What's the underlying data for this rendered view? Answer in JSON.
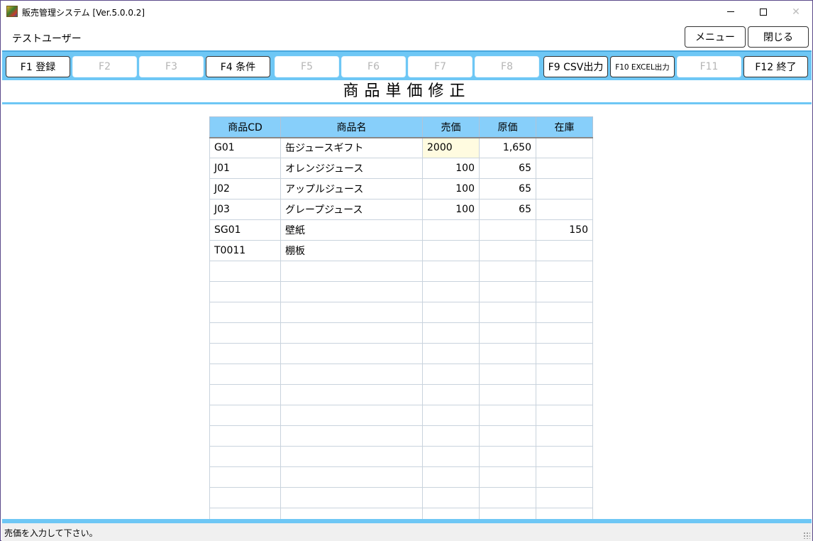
{
  "window": {
    "title": "販売管理システム [Ver.5.0.0.2]",
    "close_glyph": "✕"
  },
  "user": {
    "name": "テストユーザー"
  },
  "top_buttons": {
    "menu": "メニュー",
    "close": "閉じる"
  },
  "fkeys": [
    {
      "label": "F1 登録",
      "enabled": true
    },
    {
      "label": "F2",
      "enabled": false
    },
    {
      "label": "F3",
      "enabled": false
    },
    {
      "label": "F4 条件",
      "enabled": true
    },
    {
      "label": "F5",
      "enabled": false
    },
    {
      "label": "F6",
      "enabled": false
    },
    {
      "label": "F7",
      "enabled": false
    },
    {
      "label": "F8",
      "enabled": false
    },
    {
      "label": "F9 CSV出力",
      "enabled": true
    },
    {
      "label": "F10 EXCEL出力",
      "enabled": true
    },
    {
      "label": "F11",
      "enabled": false
    },
    {
      "label": "F12 終了",
      "enabled": true
    }
  ],
  "screen_title": "商品単価修正",
  "grid": {
    "columns": [
      "商品CD",
      "商品名",
      "売価",
      "原価",
      "在庫"
    ],
    "rows": [
      [
        "G01",
        "缶ジュースギフト",
        "2000",
        "1,650",
        ""
      ],
      [
        "J01",
        "オレンジジュース",
        "100",
        "65",
        ""
      ],
      [
        "J02",
        "アップルジュース",
        "100",
        "65",
        ""
      ],
      [
        "J03",
        "グレープジュース",
        "100",
        "65",
        ""
      ],
      [
        "SG01",
        "壁紙",
        "",
        "",
        "150"
      ],
      [
        "T0011",
        "棚板",
        "",
        "",
        ""
      ],
      [
        "",
        "",
        "",
        "",
        ""
      ],
      [
        "",
        "",
        "",
        "",
        ""
      ],
      [
        "",
        "",
        "",
        "",
        ""
      ],
      [
        "",
        "",
        "",
        "",
        ""
      ],
      [
        "",
        "",
        "",
        "",
        ""
      ],
      [
        "",
        "",
        "",
        "",
        ""
      ],
      [
        "",
        "",
        "",
        "",
        ""
      ],
      [
        "",
        "",
        "",
        "",
        ""
      ],
      [
        "",
        "",
        "",
        "",
        ""
      ],
      [
        "",
        "",
        "",
        "",
        ""
      ],
      [
        "",
        "",
        "",
        "",
        ""
      ],
      [
        "",
        "",
        "",
        "",
        ""
      ],
      [
        "",
        "",
        "",
        "",
        ""
      ]
    ],
    "editing_cell": {
      "row": 0,
      "col": 2
    }
  },
  "status": {
    "message": "売価を入力して下さい。"
  },
  "colors": {
    "accent": "#6ec7f5",
    "header": "#87cffa",
    "editing": "#fffbe0"
  }
}
